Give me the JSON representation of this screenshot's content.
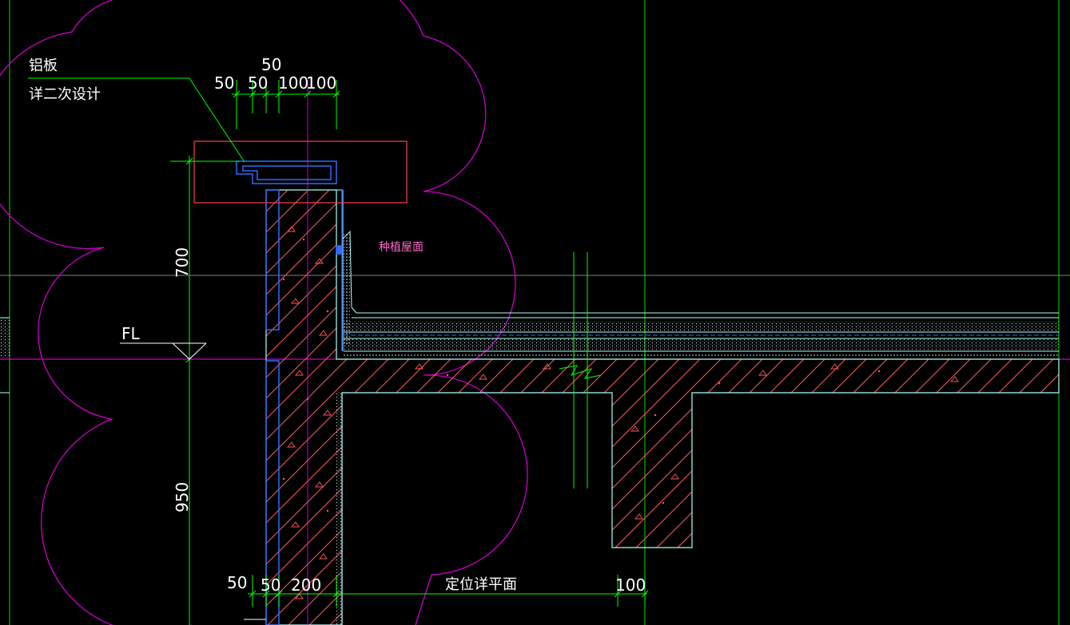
{
  "drawing": {
    "background": "#000000",
    "colors": {
      "green": "#00ff00",
      "magenta": "#ff00ff",
      "blue": "#2f6bff",
      "cyan": "#aaffff",
      "red": "#ff4040",
      "white": "#ffffff",
      "hatch": "#ff5a5a",
      "pink_text": "#ff66cc",
      "grid": "#00dd00"
    },
    "labels": {
      "aluminum_panel": "铝板",
      "secondary_design": "详二次设计",
      "planting_roof": "种植屋面",
      "floor_level": "FL",
      "positioning_plan": "定位详平面"
    },
    "dimensions": {
      "top_overall": "50",
      "top_d1": "50",
      "top_d2": "50",
      "top_d3": "100",
      "top_d4": "100",
      "vertical_upper": "700",
      "vertical_lower": "950",
      "bottom_d1": "50",
      "bottom_d2": "50",
      "bottom_d3": "200",
      "bottom_d4": "100"
    }
  }
}
